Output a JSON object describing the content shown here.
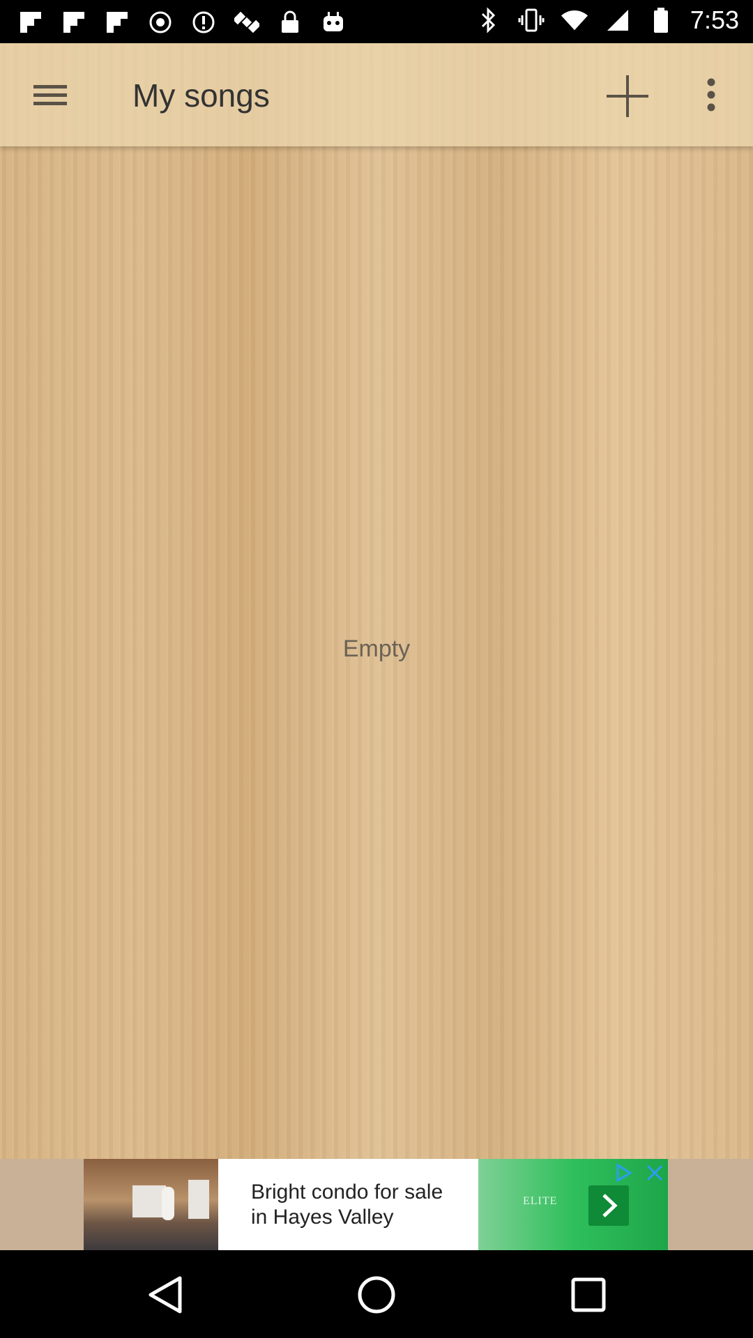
{
  "status_bar": {
    "time": "7:53",
    "left_icons": [
      "flipboard-icon",
      "flipboard-icon",
      "flipboard-icon",
      "record-icon",
      "alert-icon",
      "satellite-icon",
      "lock-icon",
      "robot-icon"
    ],
    "right_icons": [
      "bluetooth-icon",
      "vibrate-icon",
      "wifi-icon",
      "signal-icon",
      "battery-icon"
    ]
  },
  "toolbar": {
    "title": "My songs",
    "menu_icon": "hamburger-menu-icon",
    "add_icon": "plus-icon",
    "more_icon": "more-vert-icon"
  },
  "main": {
    "empty_text": "Empty"
  },
  "ad": {
    "text_line1": "Bright condo for sale",
    "text_line2": "in Hayes Valley",
    "logo_text": "ELITE",
    "cta_icon": "chevron-right-icon",
    "adchoices_icon": "adchoices-icon",
    "close_icon": "close-icon"
  },
  "nav_bar": {
    "back_icon": "back-triangle-icon",
    "home_icon": "home-circle-icon",
    "recents_icon": "recents-square-icon"
  },
  "colors": {
    "wood_light": "#e0c195",
    "wood_dark": "#d3ad7b",
    "title_text": "#333333",
    "empty_text": "#6b6255",
    "ad_green": "#2fbf5c"
  }
}
